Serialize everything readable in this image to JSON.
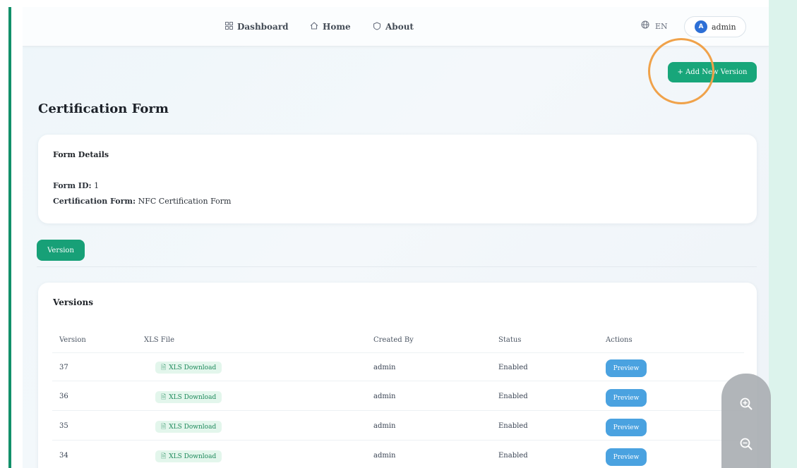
{
  "nav": {
    "dashboard": "Dashboard",
    "home": "Home",
    "about": "About",
    "language": "EN",
    "user_initial": "A",
    "user_name": "admin"
  },
  "actions": {
    "add_version": "+ Add New Version"
  },
  "page": {
    "title": "Certification Form"
  },
  "form_details": {
    "title": "Form Details",
    "form_id_label": "Form ID:",
    "form_id_value": "1",
    "cert_form_label": "Certification Form:",
    "cert_form_value": "NFC Certification Form"
  },
  "tabs": {
    "version": "Version"
  },
  "versions": {
    "title": "Versions",
    "columns": [
      "Version",
      "XLS File",
      "Created By",
      "Status",
      "Actions"
    ],
    "rows": [
      {
        "version": "37",
        "xls": "XLS Download",
        "created_by": "admin",
        "status": "Enabled",
        "action": "Preview"
      },
      {
        "version": "36",
        "xls": "XLS Download",
        "created_by": "admin",
        "status": "Enabled",
        "action": "Preview"
      },
      {
        "version": "35",
        "xls": "XLS Download",
        "created_by": "admin",
        "status": "Enabled",
        "action": "Preview"
      },
      {
        "version": "34",
        "xls": "XLS Download",
        "created_by": "admin",
        "status": "Enabled",
        "action": "Preview"
      }
    ]
  },
  "colors": {
    "primary_green": "#18a67a",
    "preview_blue": "#4aa2e0",
    "highlight_orange": "#f0a24a",
    "avatar_blue": "#2d6fd6"
  },
  "icons": {
    "dashboard": "grid-icon",
    "home": "home-icon",
    "about": "info-icon",
    "language": "globe-icon",
    "xls": "file-icon",
    "zoom_in": "zoom-in-icon",
    "zoom_out": "zoom-out-icon"
  }
}
